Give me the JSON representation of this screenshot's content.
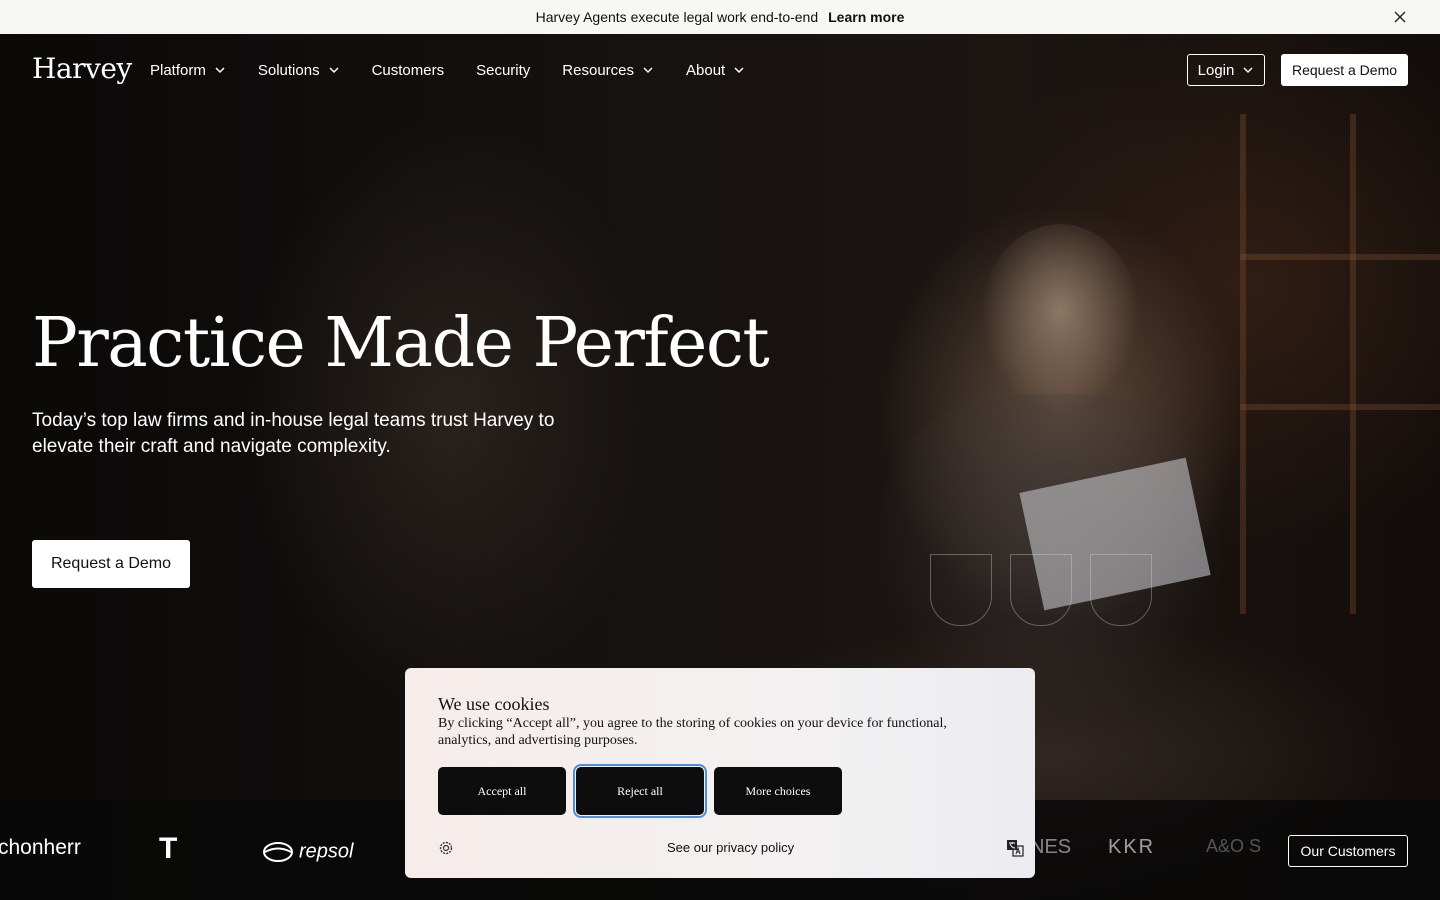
{
  "announcement": {
    "message": "Harvey Agents execute legal work end-to-end",
    "link": "Learn more"
  },
  "nav": {
    "logo": "Harvey",
    "items": [
      {
        "label": "Platform",
        "dropdown": true
      },
      {
        "label": "Solutions",
        "dropdown": true
      },
      {
        "label": "Customers",
        "dropdown": false
      },
      {
        "label": "Security",
        "dropdown": false
      },
      {
        "label": "Resources",
        "dropdown": true
      },
      {
        "label": "About",
        "dropdown": true
      }
    ],
    "login": "Login",
    "demo": "Request a Demo"
  },
  "hero": {
    "headline": "Practice Made Perfect",
    "subtitle": "Today’s top law firms and in-house legal teams trust Harvey to elevate their craft and navigate complexity.",
    "cta": "Request a Demo"
  },
  "clients": {
    "logos": [
      "chonherr",
      "T",
      "repsol",
      "NES",
      "KKR",
      "A&O S"
    ],
    "button": "Our Customers"
  },
  "cookie": {
    "title": "We use cookies",
    "body": "By clicking “Accept all”, you agree to the storing of cookies on your device for functional, analytics, and advertising purposes.",
    "accept": "Accept all",
    "reject": "Reject all",
    "more": "More choices",
    "privacy": "See our privacy policy"
  },
  "icons": {
    "close": "close-icon",
    "chevron": "chevron-down-icon",
    "settings": "settings-icon",
    "language": "language-icon"
  }
}
